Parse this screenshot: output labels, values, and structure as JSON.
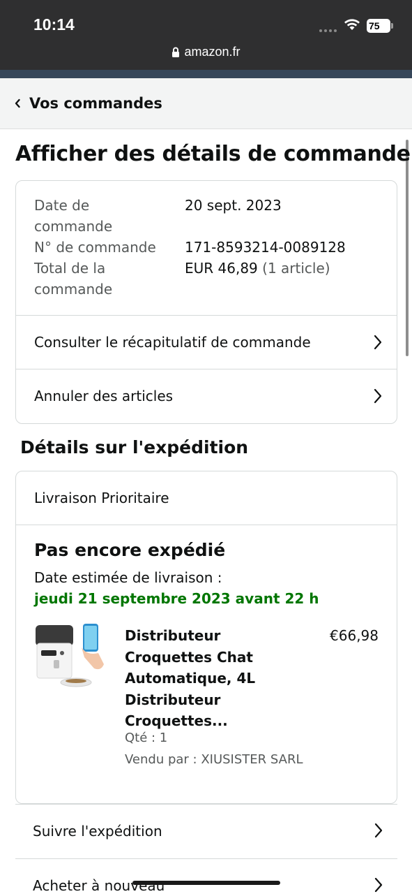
{
  "status_bar": {
    "time": "10:14",
    "battery": "75"
  },
  "browser": {
    "url": "amazon.fr"
  },
  "nav": {
    "back_label": "Vos commandes"
  },
  "page_title": "Afficher des détails de commande",
  "order_info": {
    "rows": [
      {
        "label": "Date de commande",
        "value": "20 sept. 2023"
      },
      {
        "label": "N° de commande",
        "value": "171-8593214-0089128"
      },
      {
        "label": "Total de la commande",
        "value": "EUR 46,89",
        "sub": "(1 article)"
      }
    ],
    "links": [
      {
        "label": "Consulter le récapitulatif de commande"
      },
      {
        "label": "Annuler des articles"
      }
    ]
  },
  "shipping": {
    "section_title": "Détails sur l'expédition",
    "delivery_type": "Livraison Prioritaire",
    "status": "Pas encore expédié",
    "estimate_label": "Date estimée de livraison :",
    "estimate_date": "jeudi 21 septembre 2023 avant 22 h",
    "product": {
      "title": "Distributeur Croquettes Chat Automatique, 4L Distributeur Croquettes...",
      "price": "€66,98",
      "quantity": "Qté : 1",
      "seller": "Vendu par : XIUSISTER SARL"
    }
  },
  "actions": [
    {
      "label": "Suivre l'expédition"
    },
    {
      "label": "Acheter à nouveau"
    }
  ],
  "colors": {
    "delivery_green": "#007600",
    "header_dark": "#2f2f30",
    "accent_strip": "#37475a"
  }
}
